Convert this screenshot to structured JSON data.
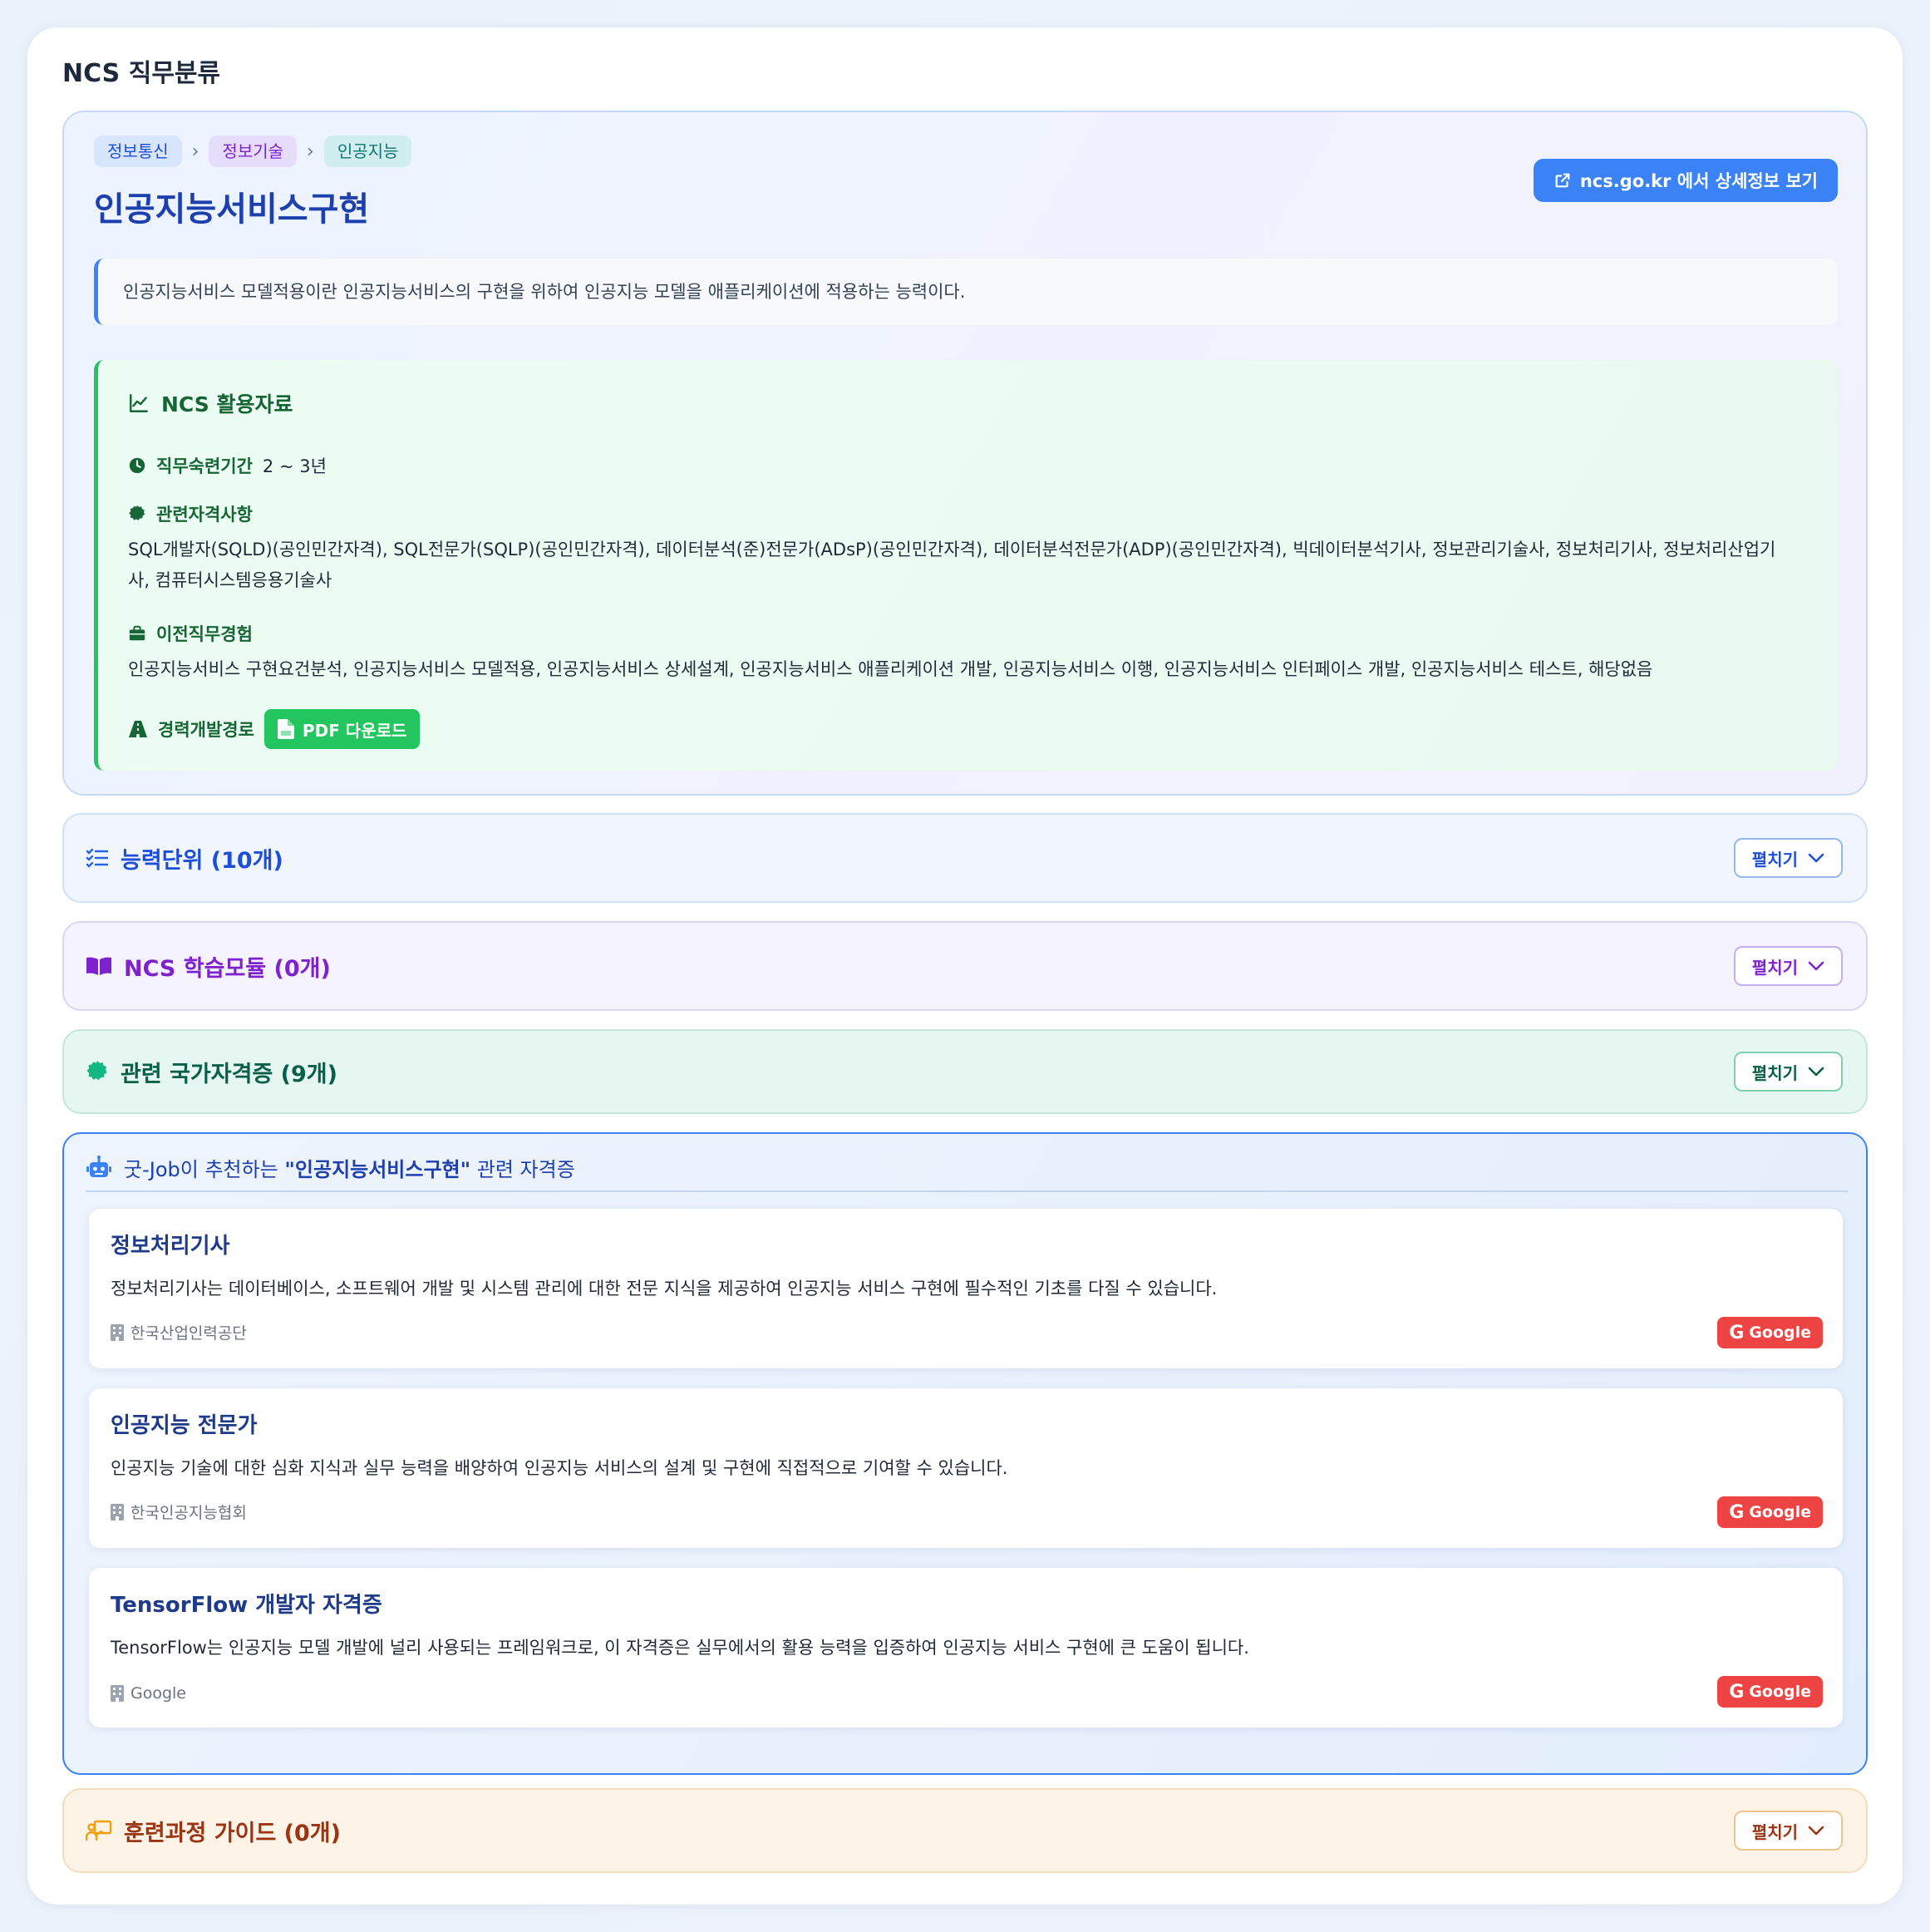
{
  "page": {
    "title": "NCS 직무분류"
  },
  "breadcrumb": [
    "정보통신",
    "정보기술",
    "인공지능"
  ],
  "job": {
    "title": "인공지능서비스구현",
    "external_link_label": "ncs.go.kr 에서 상세정보 보기",
    "description": "인공지능서비스 모델적용이란 인공지능서비스의 구현을 위하여 인공지능 모델을 애플리케이션에 적용하는 능력이다."
  },
  "resources": {
    "title": "NCS 활용자료",
    "period_label": "직무숙련기간",
    "period_value": "2 ~ 3년",
    "cert_label": "관련자격사항",
    "cert_text_line1": "SQL개발자(SQLD)(공인민간자격), SQL전문가(SQLP)(공인민간자격), 데이터분석(준)전문가(ADsP)(공인민간자격), 데이터분석전문가(ADP)(공인민간자격), 빅데이터분석기사, 정보관리기술사, 정보처리기사, 정보처리산업기",
    "cert_text_line2": "사, 컴퓨터시스템응용기술사",
    "prev_label": "이전직무경험",
    "prev_text": "인공지능서비스 구현요건분석, 인공지능서비스 모델적용, 인공지능서비스 상세설계, 인공지능서비스 애플리케이션 개발, 인공지능서비스 이행, 인공지능서비스 인터페이스 개발, 인공지능서비스 테스트, 해당없음",
    "career_label": "경력개발경로",
    "pdf_label": "PDF 다운로드"
  },
  "sections": {
    "units": {
      "title": "능력단위 (10개)",
      "toggle": "펼치기"
    },
    "modules": {
      "title": "NCS 학습모듈 (0개)",
      "toggle": "펼치기"
    },
    "certs": {
      "title": "관련 국가자격증 (9개)",
      "toggle": "펼치기"
    },
    "training": {
      "title": "훈련과정 가이드 (0개)",
      "toggle": "펼치기"
    }
  },
  "recommend": {
    "title_prefix": "굿-Job이 추천하는 ",
    "title_job": "\"인공지능서비스구현\"",
    "title_suffix": " 관련 자격증",
    "google_label": "Google",
    "items": [
      {
        "name": "정보처리기사",
        "desc": "정보처리기사는 데이터베이스, 소프트웨어 개발 및 시스템 관리에 대한 전문 지식을 제공하여 인공지능 서비스 구현에 필수적인 기초를 다질 수 있습니다.",
        "org": "한국산업인력공단"
      },
      {
        "name": "인공지능 전문가",
        "desc": "인공지능 기술에 대한 심화 지식과 실무 능력을 배양하여 인공지능 서비스의 설계 및 구현에 직접적으로 기여할 수 있습니다.",
        "org": "한국인공지능협회"
      },
      {
        "name": "TensorFlow 개발자 자격증",
        "desc": "TensorFlow는 인공지능 모델 개발에 널리 사용되는 프레임워크로, 이 자격증은 실무에서의 활용 능력을 입증하여 인공지능 서비스 구현에 큰 도움이 됩니다.",
        "org": "Google"
      }
    ]
  },
  "colors": {
    "accent": "#3b82f6",
    "success": "#22c55e",
    "danger": "#ef4444"
  }
}
